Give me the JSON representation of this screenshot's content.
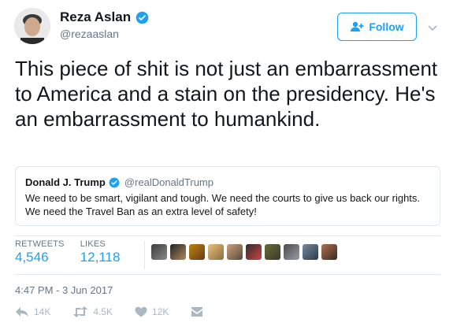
{
  "author": {
    "display_name": "Reza Aslan",
    "handle": "@rezaaslan",
    "verified": true
  },
  "header": {
    "follow_label": "Follow"
  },
  "tweet": {
    "text": "This piece of shit is not just an embarrassment to America and a stain on the presidency. He's an embarrassment to humankind."
  },
  "quoted_tweet": {
    "display_name": "Donald J. Trump",
    "handle": "@realDonaldTrump",
    "verified": true,
    "text": "We need to be smart, vigilant and tough. We need the courts to give us back our rights. We need the Travel Ban as an extra level of safety!"
  },
  "stats": {
    "retweets_label": "RETWEETS",
    "retweets_value": "4,546",
    "likes_label": "LIKES",
    "likes_value": "12,118"
  },
  "timestamp": "4:47 PM - 3 Jun 2017",
  "actions": {
    "reply_count": "14K",
    "retweet_count": "4.5K",
    "like_count": "12K"
  },
  "colors": {
    "accent": "#1da1f2",
    "muted": "#657786",
    "border": "#e1e8ed",
    "action_gray": "#aab8c2"
  },
  "icons": [
    "verified-badge-icon",
    "follow-person-icon",
    "chevron-down-icon",
    "reply-icon",
    "retweet-icon",
    "heart-icon",
    "direct-message-icon"
  ]
}
